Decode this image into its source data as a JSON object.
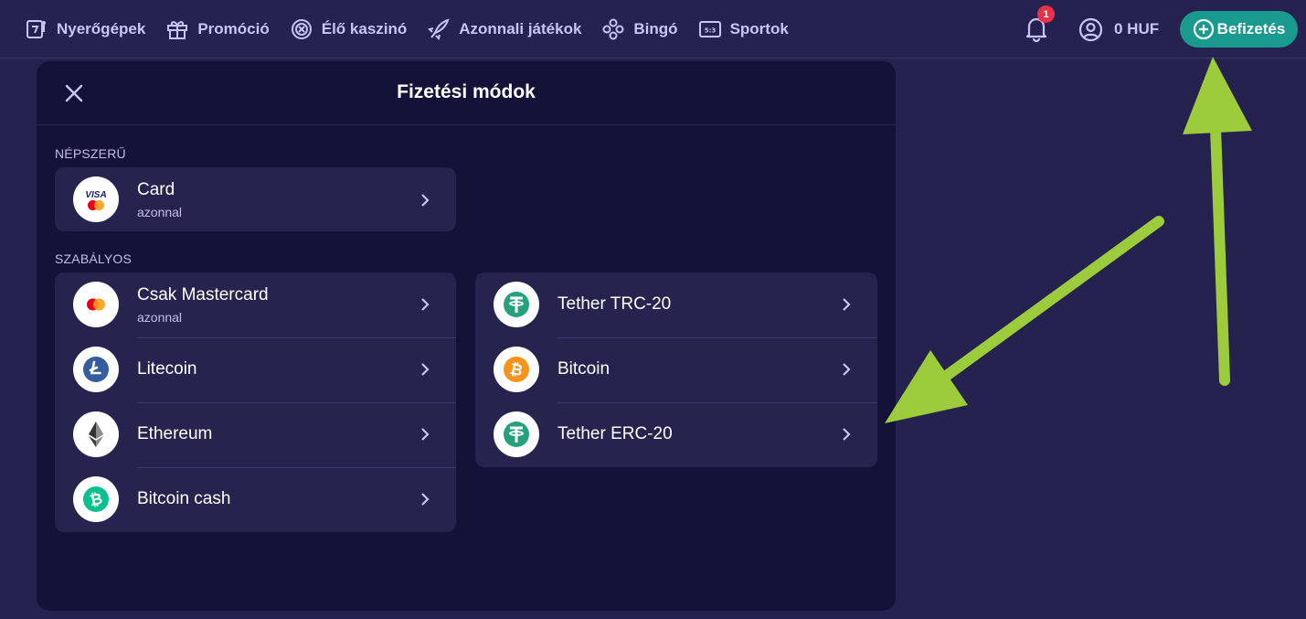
{
  "nav": {
    "items": [
      {
        "label": "Nyerőgépek",
        "icon": "slot-machine-icon"
      },
      {
        "label": "Promóció",
        "icon": "gift-icon"
      },
      {
        "label": "Élő kaszinó",
        "icon": "roulette-icon"
      },
      {
        "label": "Azonnali játékok",
        "icon": "rocket-icon"
      },
      {
        "label": "Bingó",
        "icon": "bingo-balls-icon"
      },
      {
        "label": "Sportok",
        "icon": "scoreboard-icon"
      }
    ]
  },
  "header": {
    "notification_count": "1",
    "balance": "0 HUF",
    "deposit_label": "Befizetés"
  },
  "modal": {
    "title": "Fizetési módok",
    "popular_label": "NÉPSZERŰ",
    "regular_label": "SZABÁLYOS",
    "popular": [
      {
        "title": "Card",
        "subtitle": "azonnal",
        "icon": "visa-mastercard-icon"
      }
    ],
    "regular_left": [
      {
        "title": "Csak Mastercard",
        "subtitle": "azonnal",
        "icon": "mastercard-icon"
      },
      {
        "title": "Litecoin",
        "icon": "litecoin-icon"
      },
      {
        "title": "Ethereum",
        "icon": "ethereum-icon"
      },
      {
        "title": "Bitcoin cash",
        "icon": "bitcoin-cash-icon"
      }
    ],
    "regular_right": [
      {
        "title": "Tether TRC-20",
        "icon": "tether-icon"
      },
      {
        "title": "Bitcoin",
        "icon": "bitcoin-icon"
      },
      {
        "title": "Tether ERC-20",
        "icon": "tether-icon"
      }
    ]
  },
  "colors": {
    "background": "#25224f",
    "modal": "#15123a",
    "row": "#27234f",
    "deposit": "#1a9a8e",
    "annotation_arrow": "#9ccb3b",
    "badge": "#e8324a"
  }
}
